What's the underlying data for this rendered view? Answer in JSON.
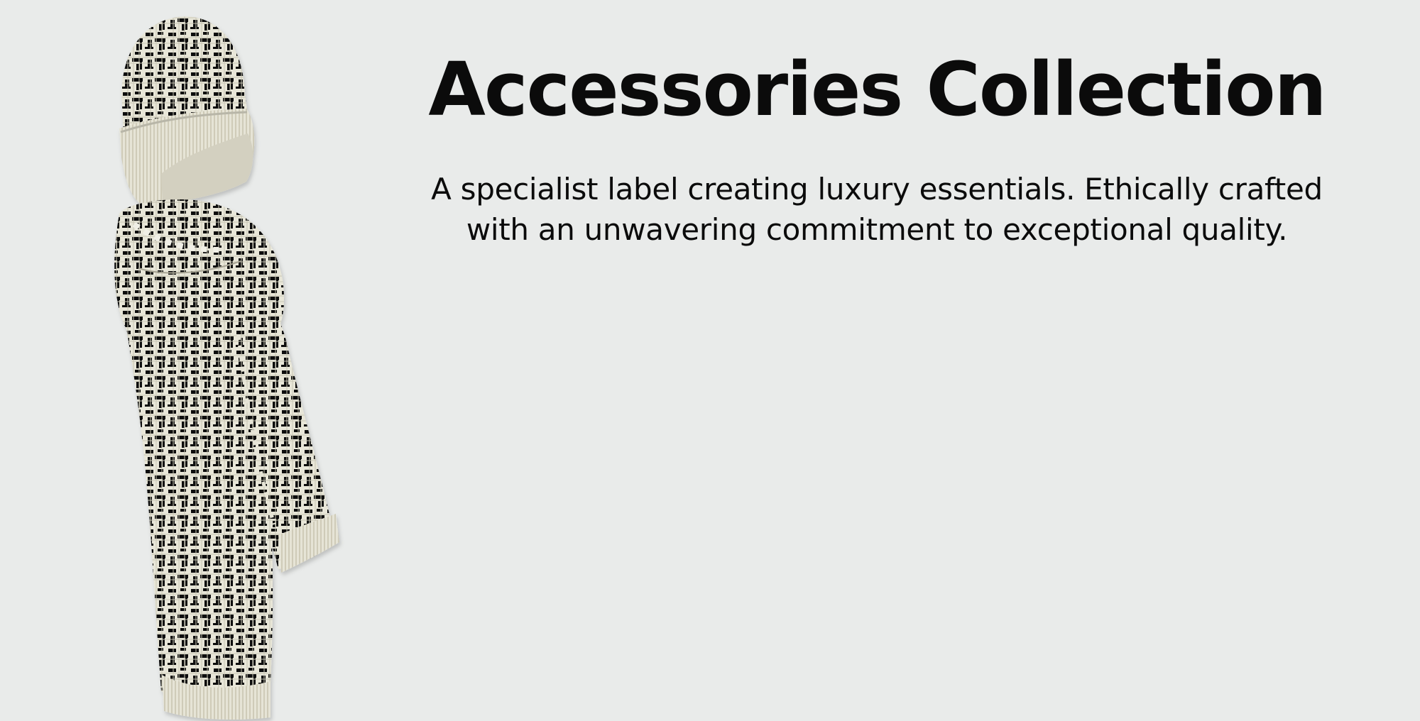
{
  "page": {
    "background_color": "#e9ebea",
    "text_color": "#0b0b0b"
  },
  "hero": {
    "title": "Accessories Collection",
    "subtitle": "A specialist label creating luxury essentials. Ethically crafted with an unwavering commitment to exceptional quality."
  },
  "product_image": {
    "subject": "hat-and-scarf",
    "colors": {
      "cream": "#e8e6d8",
      "black": "#111111",
      "shadow": "#b8b6a8"
    }
  }
}
